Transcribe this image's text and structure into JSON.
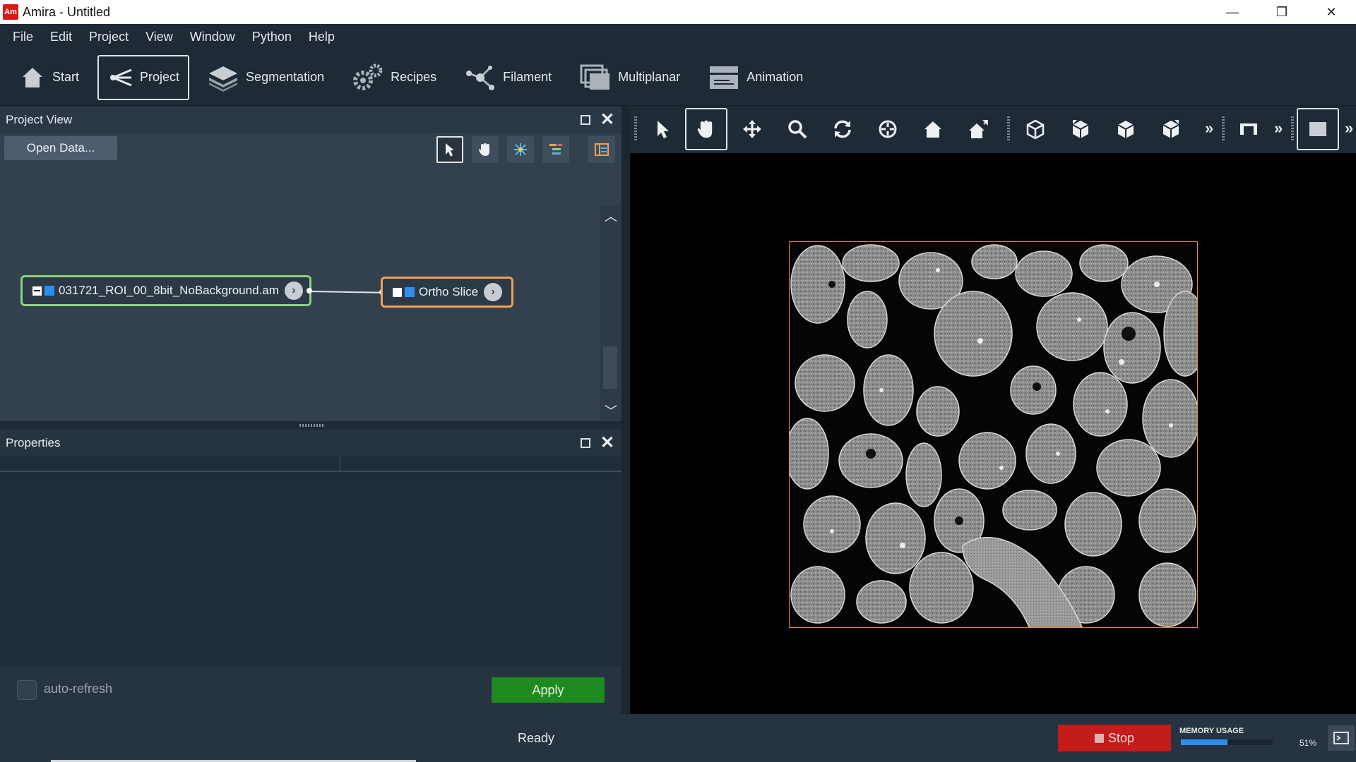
{
  "window": {
    "logo_text": "Am",
    "title": "Amira - Untitled",
    "controls": {
      "minimize": "—",
      "restore": "❐",
      "close": "✕"
    }
  },
  "menu": [
    "File",
    "Edit",
    "Project",
    "View",
    "Window",
    "Python",
    "Help"
  ],
  "workrooms": [
    {
      "label": "Start",
      "icon": "home-icon",
      "active": false
    },
    {
      "label": "Project",
      "icon": "project-graph-icon",
      "active": true
    },
    {
      "label": "Segmentation",
      "icon": "layers-icon",
      "active": false
    },
    {
      "label": "Recipes",
      "icon": "gears-icon",
      "active": false
    },
    {
      "label": "Filament",
      "icon": "filament-icon",
      "active": false
    },
    {
      "label": "Multiplanar",
      "icon": "multiplanar-icon",
      "active": false
    },
    {
      "label": "Animation",
      "icon": "clapper-icon",
      "active": false
    }
  ],
  "project_view": {
    "title": "Project View",
    "open_data_label": "Open Data...",
    "tools": [
      "pointer-tool-icon",
      "hand-tool-icon",
      "graph-layout-icon",
      "tree-view-icon",
      "panel-layout-icon"
    ],
    "nodes": {
      "data_node": {
        "label": "031721_ROI_00_8bit_NoBackground.am",
        "type": "data"
      },
      "module_node": {
        "label": "Ortho Slice",
        "type": "module"
      }
    }
  },
  "properties": {
    "title": "Properties",
    "auto_refresh_label": "auto-refresh",
    "apply_label": "Apply"
  },
  "viewer_toolbar": {
    "tools": [
      "select-icon",
      "hand-icon",
      "move-icon",
      "zoom-icon",
      "rotate-icon",
      "seek-icon",
      "home-icon",
      "set-home-icon",
      "view-cube-icon",
      "view-front-icon",
      "view-side-icon",
      "view-top-icon",
      "more-icon",
      "layout-icon",
      "more-icon",
      "single-viewer-icon",
      "more-icon"
    ]
  },
  "status": {
    "text": "Ready",
    "stop_label": "Stop",
    "memory_label": "MEMORY USAGE",
    "memory_percent_text": "51%",
    "memory_fraction": 0.51
  },
  "colors": {
    "data_node_border": "#8ad27c",
    "module_node_border": "#f2a055",
    "apply_green": "#1f8a1f",
    "stop_red": "#c41b1b",
    "slice_frame": "#e98a30"
  }
}
